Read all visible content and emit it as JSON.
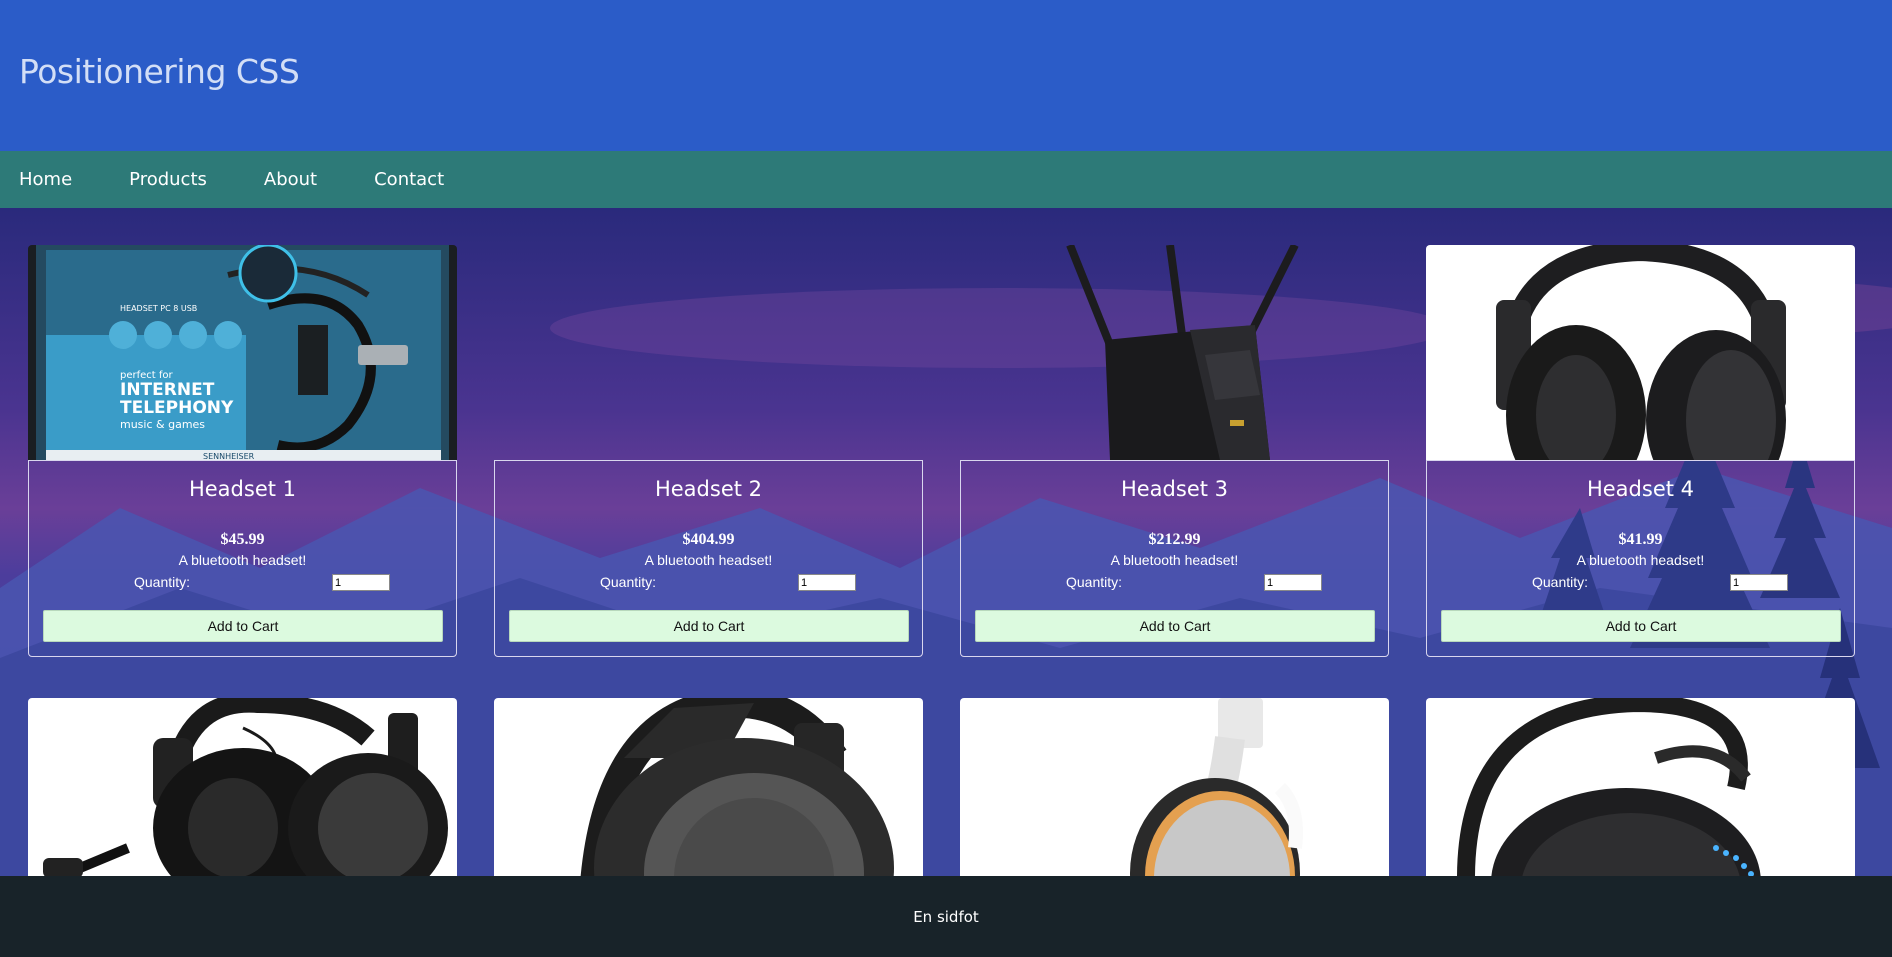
{
  "header": {
    "title": "Positionering CSS"
  },
  "nav": {
    "items": [
      "Home",
      "Products",
      "About",
      "Contact"
    ]
  },
  "products": [
    {
      "name": "Headset 1",
      "price": "$45.99",
      "description": "A bluetooth headset!",
      "quantity_label": "Quantity:",
      "quantity": "1",
      "button": "Add to Cart",
      "image": "sennheiser-headset-box"
    },
    {
      "name": "Headset 2",
      "price": "$404.99",
      "description": "A bluetooth headset!",
      "quantity_label": "Quantity:",
      "quantity": "1",
      "button": "Add to Cart",
      "image": "none"
    },
    {
      "name": "Headset 3",
      "price": "$212.99",
      "description": "A bluetooth headset!",
      "quantity_label": "Quantity:",
      "quantity": "1",
      "button": "Add to Cart",
      "image": "router"
    },
    {
      "name": "Headset 4",
      "price": "$41.99",
      "description": "A bluetooth headset!",
      "quantity_label": "Quantity:",
      "quantity": "1",
      "button": "Add to Cart",
      "image": "black-headphones"
    }
  ],
  "products_row2": [
    {
      "image": "gaming-headset-black"
    },
    {
      "image": "gaming-headset-grey"
    },
    {
      "image": "white-orange-headset"
    },
    {
      "image": "black-headset-blue-lights"
    }
  ],
  "box_text": {
    "line1": "HEADSET PC 8 USB",
    "line2": "perfect for",
    "line3": "INTERNET",
    "line4": "TELEPHONY",
    "line5": "music & games",
    "brand": "SENNHEISER"
  },
  "footer": {
    "text": "En sidfot"
  },
  "colors": {
    "header": "#2b5cc8",
    "nav": "#2d7a78",
    "footer": "#182329",
    "button": "#dcfadf"
  }
}
